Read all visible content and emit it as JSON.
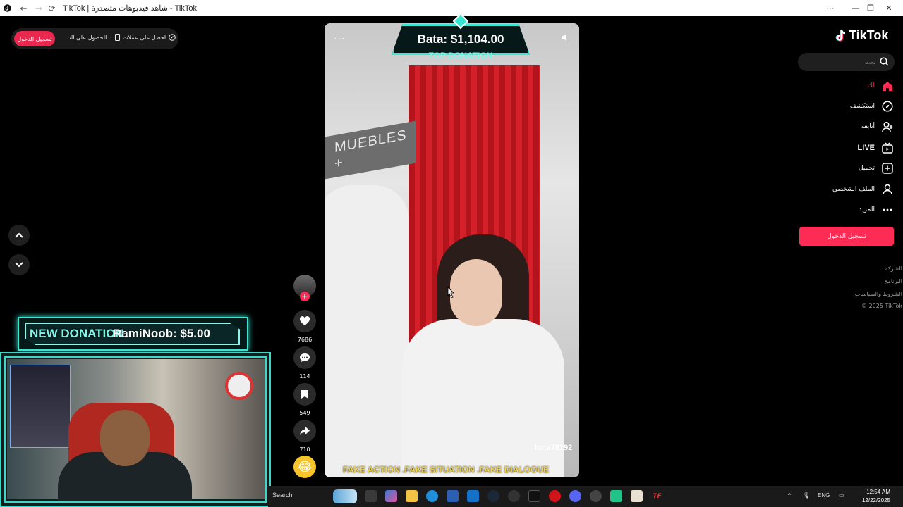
{
  "browser": {
    "tab_title": "TikTok | شاهد فيديوهات متصدرة - TikTok",
    "controls": {
      "more": "⋯",
      "minimize": "—",
      "restore": "❐",
      "close": "✕"
    }
  },
  "top_bar": {
    "login_label": "تسجيل الدخول",
    "get_app_label": "الحصول على التـ...",
    "get_coins_label": "احصل على عملات"
  },
  "nav_arrows": {
    "up": "previous-video",
    "down": "next-video"
  },
  "donation_banner": {
    "prefix": "NEW DONATION",
    "text": "RamiNoob: $5.00"
  },
  "video": {
    "top_donation_amount": "Bata: $1,104.00",
    "top_donation_label": "TOP DONATION",
    "store_sign": "MUEBLES +",
    "username": "luna78192",
    "caption": "FAKE ACTION .FAKE SITUATION .FAKE DIALOGUE",
    "more": "···"
  },
  "actions": {
    "likes": "7686",
    "comments": "114",
    "bookmarks": "549",
    "shares": "710",
    "follow": "+",
    "emoji": "😂"
  },
  "sidebar": {
    "logo": "TikTok",
    "search_placeholder": "بحث",
    "items": [
      {
        "label": "لك",
        "icon": "home-icon",
        "active": true
      },
      {
        "label": "استكشف",
        "icon": "compass-icon"
      },
      {
        "label": "أتابعه",
        "icon": "following-icon"
      },
      {
        "label": "LIVE",
        "icon": "live-icon"
      },
      {
        "label": "تحميل",
        "icon": "upload-icon"
      },
      {
        "label": "الملف الشخصي",
        "icon": "profile-icon"
      },
      {
        "label": "المزيد",
        "icon": "more-icon"
      }
    ],
    "login_button": "تسجيل الدخول",
    "footer": [
      "الشركة",
      "البرنامج",
      "الشروط والسياسات",
      "© 2025 TikTok"
    ]
  },
  "taskbar": {
    "search_label": "Search",
    "language": "ENG",
    "time": "12:54 AM",
    "date": "12/22/2025"
  },
  "colors": {
    "accent": "#fe2c55",
    "stream_overlay": "#38e6d2"
  }
}
